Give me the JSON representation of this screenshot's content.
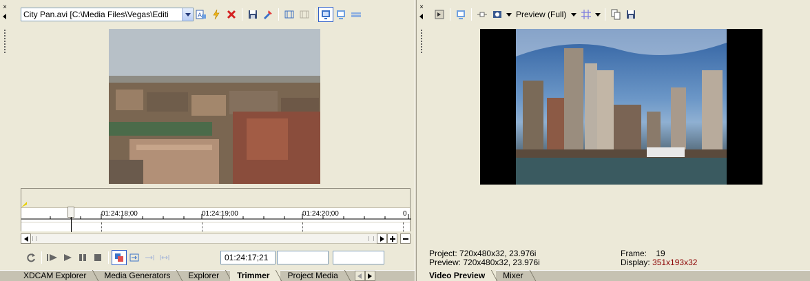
{
  "trimmer": {
    "media_combo": "City Pan.avi   [C:\\Media Files\\Vegas\\Editi",
    "timeline": {
      "ticks": [
        "01:24:18;00",
        "01:24:19;00",
        "01:24:20;00",
        "0"
      ]
    },
    "timecode": "01:24:17;21",
    "tabs": [
      "XDCAM Explorer",
      "Media Generators",
      "Explorer",
      "Trimmer",
      "Project Media"
    ],
    "active_tab": "Trimmer"
  },
  "preview": {
    "quality_label": "Preview (Full)",
    "project_label": "Project:",
    "project_value": "720x480x32, 23.976i",
    "preview_label": "Preview:",
    "preview_value": "720x480x32, 23.976i",
    "frame_label": "Frame:",
    "frame_value": "19",
    "display_label": "Display:",
    "display_value": "351x193x32",
    "display_value_color": "#8b0000",
    "tabs": [
      "Video Preview",
      "Mixer"
    ],
    "active_tab": "Video Preview"
  },
  "icons": {
    "close": "×"
  }
}
